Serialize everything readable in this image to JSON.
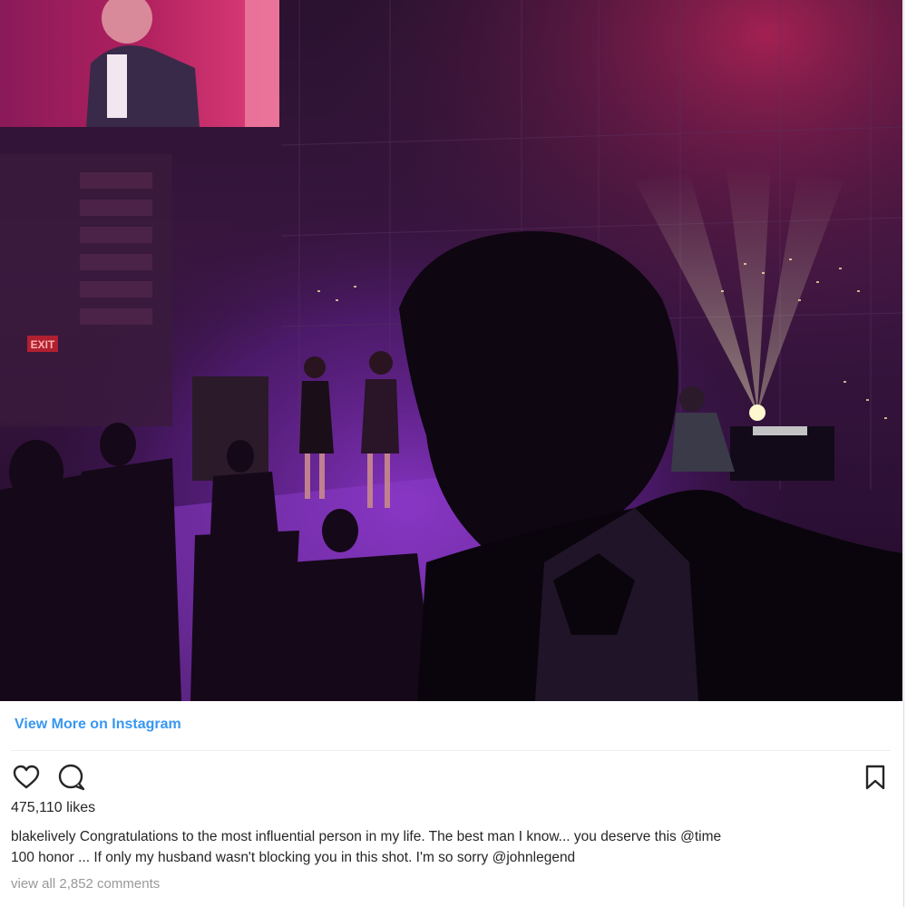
{
  "post": {
    "view_more_label": "View More on Instagram",
    "likes_text": "475,110 likes",
    "caption": {
      "username": "blakelively",
      "text_line1": "Congratulations to the most influential person in my life. The best man I know... you deserve this @time",
      "text_line2": "100 honor ... If only my husband wasn't blocking you in this shot. I'm so sorry @johnlegend"
    },
    "view_all_comments": "view all 2,852 comments",
    "exit_sign": "EXIT"
  },
  "icons": {
    "like": "heart-icon",
    "comment": "comment-bubble-icon",
    "save": "bookmark-icon"
  },
  "colors": {
    "link_blue": "#3897f0",
    "text": "#262626",
    "muted": "#999999",
    "stage_purple": "#7a2fb0",
    "screen_red": "#d4245a"
  }
}
